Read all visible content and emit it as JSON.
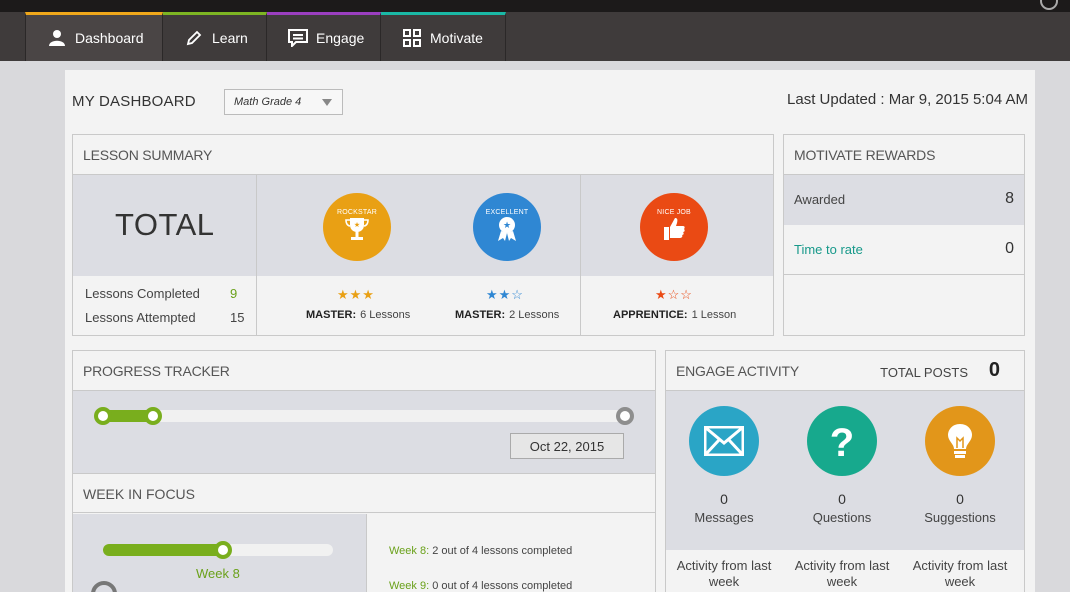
{
  "nav": {
    "tabs": [
      {
        "label": "Dashboard",
        "icon": "user-icon",
        "accent": "#f0a81b"
      },
      {
        "label": "Learn",
        "icon": "pencil-icon",
        "accent": "#7db523"
      },
      {
        "label": "Engage",
        "icon": "chat-icon",
        "accent": "#9b3fc0"
      },
      {
        "label": "Motivate",
        "icon": "grid-icon",
        "accent": "#1ab9a6"
      }
    ]
  },
  "header": {
    "title": "MY DASHBOARD",
    "grade_select": "Math Grade 4",
    "last_updated": "Last Updated : Mar 9, 2015 5:04 AM"
  },
  "lesson_summary": {
    "title": "LESSON SUMMARY",
    "total_label": "TOTAL",
    "completed_label": "Lessons Completed",
    "completed_value": "9",
    "attempted_label": "Lessons Attempted",
    "attempted_value": "15",
    "badges": [
      {
        "name": "ROCKSTAR",
        "color": "#e9a014",
        "stars": "★★★",
        "star_color": "#e9a014",
        "level": "MASTER:",
        "lessons": "6 Lessons"
      },
      {
        "name": "EXCELLENT",
        "color": "#2f87d3",
        "stars": "★★☆",
        "star_color": "#2f87d3",
        "level": "MASTER:",
        "lessons": "2 Lessons"
      },
      {
        "name": "NICE JOB",
        "color": "#ea4a14",
        "stars": "★☆☆",
        "star_color": "#ea4a14",
        "level": "APPRENTICE:",
        "lessons": "1 Lesson"
      }
    ]
  },
  "motivate_rewards": {
    "title": "MOTIVATE REWARDS",
    "awarded_label": "Awarded",
    "awarded_value": "8",
    "rate_label": "Time to rate",
    "rate_value": "0"
  },
  "progress_tracker": {
    "title": "PROGRESS TRACKER",
    "progress_fraction": 0.09,
    "end_date": "Oct 22, 2015"
  },
  "week_in_focus": {
    "title": "WEEK IN FOCUS",
    "week_label": "Week 8",
    "week_fraction": 0.5,
    "lines": [
      {
        "week": "Week 8:",
        "text": " 2 out of 4 lessons completed"
      },
      {
        "week": "Week 9:",
        "text": " 0 out of 4 lessons completed"
      }
    ]
  },
  "engage_activity": {
    "title": "ENGAGE ACTIVITY",
    "total_posts_label": "TOTAL POSTS",
    "total_posts_value": "0",
    "items": [
      {
        "icon": "envelope-icon",
        "color": "#2aa5c6",
        "count": "0",
        "label": "Messages",
        "from": "Activity from last week"
      },
      {
        "icon": "question-icon",
        "color": "#17a98d",
        "count": "0",
        "label": "Questions",
        "from": "Activity from last week"
      },
      {
        "icon": "lightbulb-icon",
        "color": "#e2961a",
        "count": "0",
        "label": "Suggestions",
        "from": "Activity from last week"
      }
    ]
  }
}
